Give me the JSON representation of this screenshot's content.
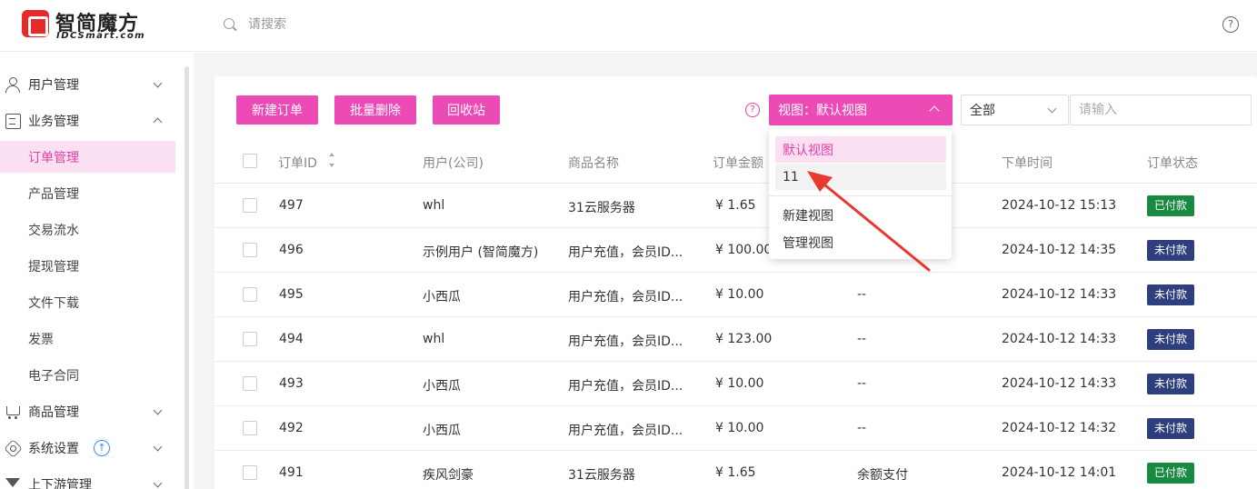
{
  "app": {
    "logo_title": "智简魔方",
    "logo_sub": "IDCSmart.com"
  },
  "search": {
    "placeholder": "请搜索"
  },
  "sidebar": {
    "items": [
      {
        "label": "用户管理"
      },
      {
        "label": "业务管理"
      },
      {
        "label": "商品管理"
      },
      {
        "label": "系统设置"
      },
      {
        "label": "上下游管理"
      }
    ],
    "sub_items": [
      {
        "label": "订单管理"
      },
      {
        "label": "产品管理"
      },
      {
        "label": "交易流水"
      },
      {
        "label": "提现管理"
      },
      {
        "label": "文件下载"
      },
      {
        "label": "发票"
      },
      {
        "label": "电子合同"
      }
    ]
  },
  "toolbar": {
    "new_order": "新建订单",
    "batch_delete": "批量删除",
    "recycle_bin": "回收站",
    "view_select": "视图：默认视图",
    "filter_select": "全部",
    "filter_placeholder": "请输入"
  },
  "view_dropdown": {
    "items": [
      "默认视图",
      "11"
    ],
    "actions": [
      "新建视图",
      "管理视图"
    ]
  },
  "table": {
    "headers": {
      "order_id": "订单ID",
      "user": "用户(公司)",
      "product": "商品名称",
      "amount": "订单金额",
      "time": "下单时间",
      "status": "订单状态"
    },
    "rows": [
      {
        "id": "497",
        "user": "whl",
        "product": "31云服务器",
        "amount": "¥ 1.65",
        "pay": "",
        "time": "2024-10-12 15:13",
        "status": "已付款",
        "status_color": "#188a42"
      },
      {
        "id": "496",
        "user": "示例用户 (智简魔方)",
        "product": "用户充值，会员ID...",
        "amount": "¥ 100.00",
        "pay": "",
        "time": "2024-10-12 14:35",
        "status": "未付款",
        "status_color": "#2f3f7e"
      },
      {
        "id": "495",
        "user": "小西瓜",
        "product": "用户充值，会员ID...",
        "amount": "¥ 10.00",
        "pay": "--",
        "time": "2024-10-12 14:33",
        "status": "未付款",
        "status_color": "#2f3f7e"
      },
      {
        "id": "494",
        "user": "whl",
        "product": "用户充值，会员ID...",
        "amount": "¥ 123.00",
        "pay": "--",
        "time": "2024-10-12 14:33",
        "status": "未付款",
        "status_color": "#2f3f7e"
      },
      {
        "id": "493",
        "user": "小西瓜",
        "product": "用户充值，会员ID...",
        "amount": "¥ 10.00",
        "pay": "--",
        "time": "2024-10-12 14:33",
        "status": "未付款",
        "status_color": "#2f3f7e"
      },
      {
        "id": "492",
        "user": "小西瓜",
        "product": "用户充值，会员ID...",
        "amount": "¥ 10.00",
        "pay": "--",
        "time": "2024-10-12 14:32",
        "status": "未付款",
        "status_color": "#2f3f7e"
      },
      {
        "id": "491",
        "user": "疾风剑豪",
        "product": "31云服务器",
        "amount": "¥ 1.65",
        "pay": "余额支付",
        "time": "2024-10-12 14:01",
        "status": "已付款",
        "status_color": "#188a42"
      }
    ]
  },
  "colors": {
    "accent": "#ec4bb5",
    "accent_light": "#fbe0f1",
    "annotation_arrow": "#e8382f"
  },
  "icons": {
    "search": "search-icon",
    "help": "help-icon",
    "upgrade": "upgrade-icon"
  }
}
